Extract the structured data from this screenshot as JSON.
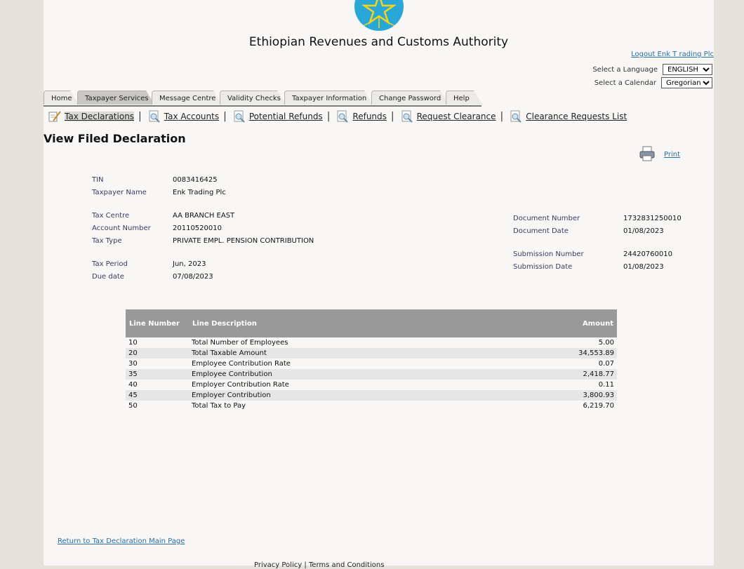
{
  "header": {
    "title": "Ethiopian Revenues and Customs Authority",
    "logout": "Logout Enk T rading Plc",
    "language_label": "Select a Language",
    "language_value": "ENGLISH",
    "calendar_label": "Select a Calendar",
    "calendar_value": "Gregorian"
  },
  "tabs": [
    {
      "label": "Home"
    },
    {
      "label": "Taxpayer Services",
      "active": true
    },
    {
      "label": "Message Centre"
    },
    {
      "label": "Validity Checks"
    },
    {
      "label": "Taxpayer Information"
    },
    {
      "label": "Change Password"
    },
    {
      "label": "Help"
    }
  ],
  "subnav": [
    {
      "label": "Tax Declarations",
      "icon": "pen-document-icon",
      "active": true
    },
    {
      "label": "Tax Accounts",
      "icon": "magnifier-document-icon"
    },
    {
      "label": "Potential Refunds",
      "icon": "magnifier-document-icon"
    },
    {
      "label": "Refunds",
      "icon": "magnifier-document-icon"
    },
    {
      "label": "Request Clearance",
      "icon": "magnifier-document-icon"
    },
    {
      "label": "Clearance Requests List",
      "icon": "magnifier-document-icon"
    }
  ],
  "page_title": "View Filed Declaration",
  "print_label": "Print",
  "taxpayer": {
    "tin_label": "TIN",
    "tin": "0083416425",
    "name_label": "Taxpayer Name",
    "name": "Enk Trading Plc",
    "centre_label": "Tax Centre",
    "centre": "AA BRANCH EAST",
    "account_label": "Account Number",
    "account": "20110520010",
    "type_label": "Tax Type",
    "type": "PRIVATE EMPL. PENSION CONTRIBUTION",
    "period_label": "Tax Period",
    "period": "Jun, 2023",
    "due_label": "Due date",
    "due": "07/08/2023"
  },
  "document": {
    "doc_number_label": "Document Number",
    "doc_number": "1732831250010",
    "doc_date_label": "Document Date",
    "doc_date": "01/08/2023",
    "sub_number_label": "Submission Number",
    "sub_number": "24420760010",
    "sub_date_label": "Submission Date",
    "sub_date": "01/08/2023"
  },
  "lines_table": {
    "headers": [
      "Line Number",
      "Line Description",
      "Amount"
    ],
    "rows": [
      {
        "num": "10",
        "desc": "Total Number of Employees",
        "amount": "5.00"
      },
      {
        "num": "20",
        "desc": "Total Taxable Amount",
        "amount": "34,553.89"
      },
      {
        "num": "30",
        "desc": "Employee Contribution Rate",
        "amount": "0.07"
      },
      {
        "num": "35",
        "desc": "Employee Contribution",
        "amount": "2,418.77"
      },
      {
        "num": "40",
        "desc": "Employer Contribution Rate",
        "amount": "0.11"
      },
      {
        "num": "45",
        "desc": "Employer Contribution",
        "amount": "3,800.93"
      },
      {
        "num": "50",
        "desc": "Total Tax to Pay",
        "amount": "6,219.70"
      }
    ]
  },
  "return_link": "Return to Tax Declaration Main Page",
  "footer": "Privacy Policy | Terms and Conditions",
  "colors": {
    "accent_link": "#2a6ea6",
    "table_header": "#999999",
    "emblem_blue": "#29a8d8",
    "emblem_star": "#f7d417"
  }
}
